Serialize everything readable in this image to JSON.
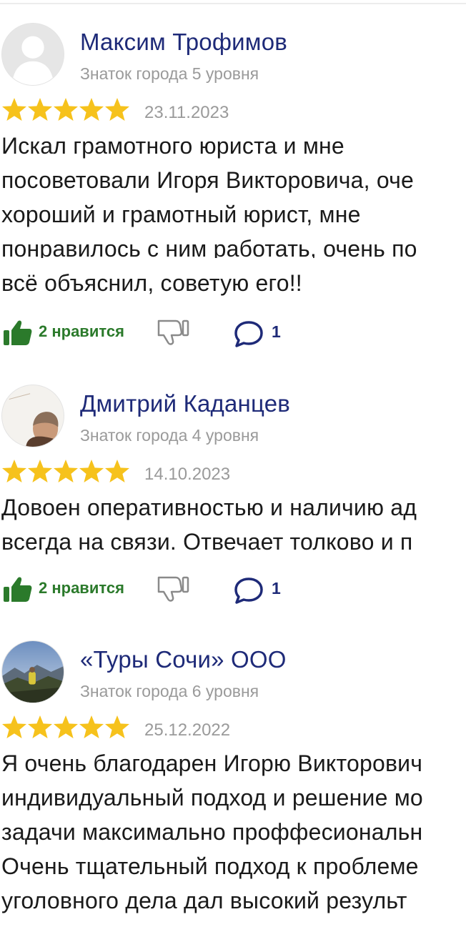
{
  "colors": {
    "author": "#1e2a78",
    "meta": "#9a9a9a",
    "star": "#f6c21c",
    "like": "#2b7a2b",
    "text": "#1a1a1a"
  },
  "reviews": [
    {
      "author": "Максим Трофимов",
      "level": "Знаток города 5 уровня",
      "avatar": "default-user-avatar",
      "rating": 5,
      "date": "23.11.2023",
      "lines": [
        "Искал грамотного юриста и мне",
        "посоветовали Игоря Викторовича, оче",
        "хороший и грамотный юрист, мне",
        "понравилось с ним работать, очень по",
        "всё объяснил, советую его!!"
      ],
      "likes_label": "2 нравится",
      "comments": "1"
    },
    {
      "author": "Дмитрий Каданцев",
      "level": "Знаток города 4 уровня",
      "avatar": "photo-avatar-man",
      "rating": 5,
      "date": "14.10.2023",
      "lines": [
        "Довоен оперативностью и наличию ад",
        "всегда на связи. Отвечает толково и п"
      ],
      "likes_label": "2 нравится",
      "comments": "1"
    },
    {
      "author": "«Туры Сочи» ООО",
      "level": "Знаток города 6 уровня",
      "avatar": "photo-avatar-mountains",
      "rating": 5,
      "date": "25.12.2022",
      "lines": [
        "Я очень благодарен Игорю Викторович",
        "индивидуальный подход и решение мо",
        "задачи максимально проффесиональн",
        "Очень тщательный подход к проблеме",
        "уголовного дела дал высокий результ"
      ]
    }
  ]
}
